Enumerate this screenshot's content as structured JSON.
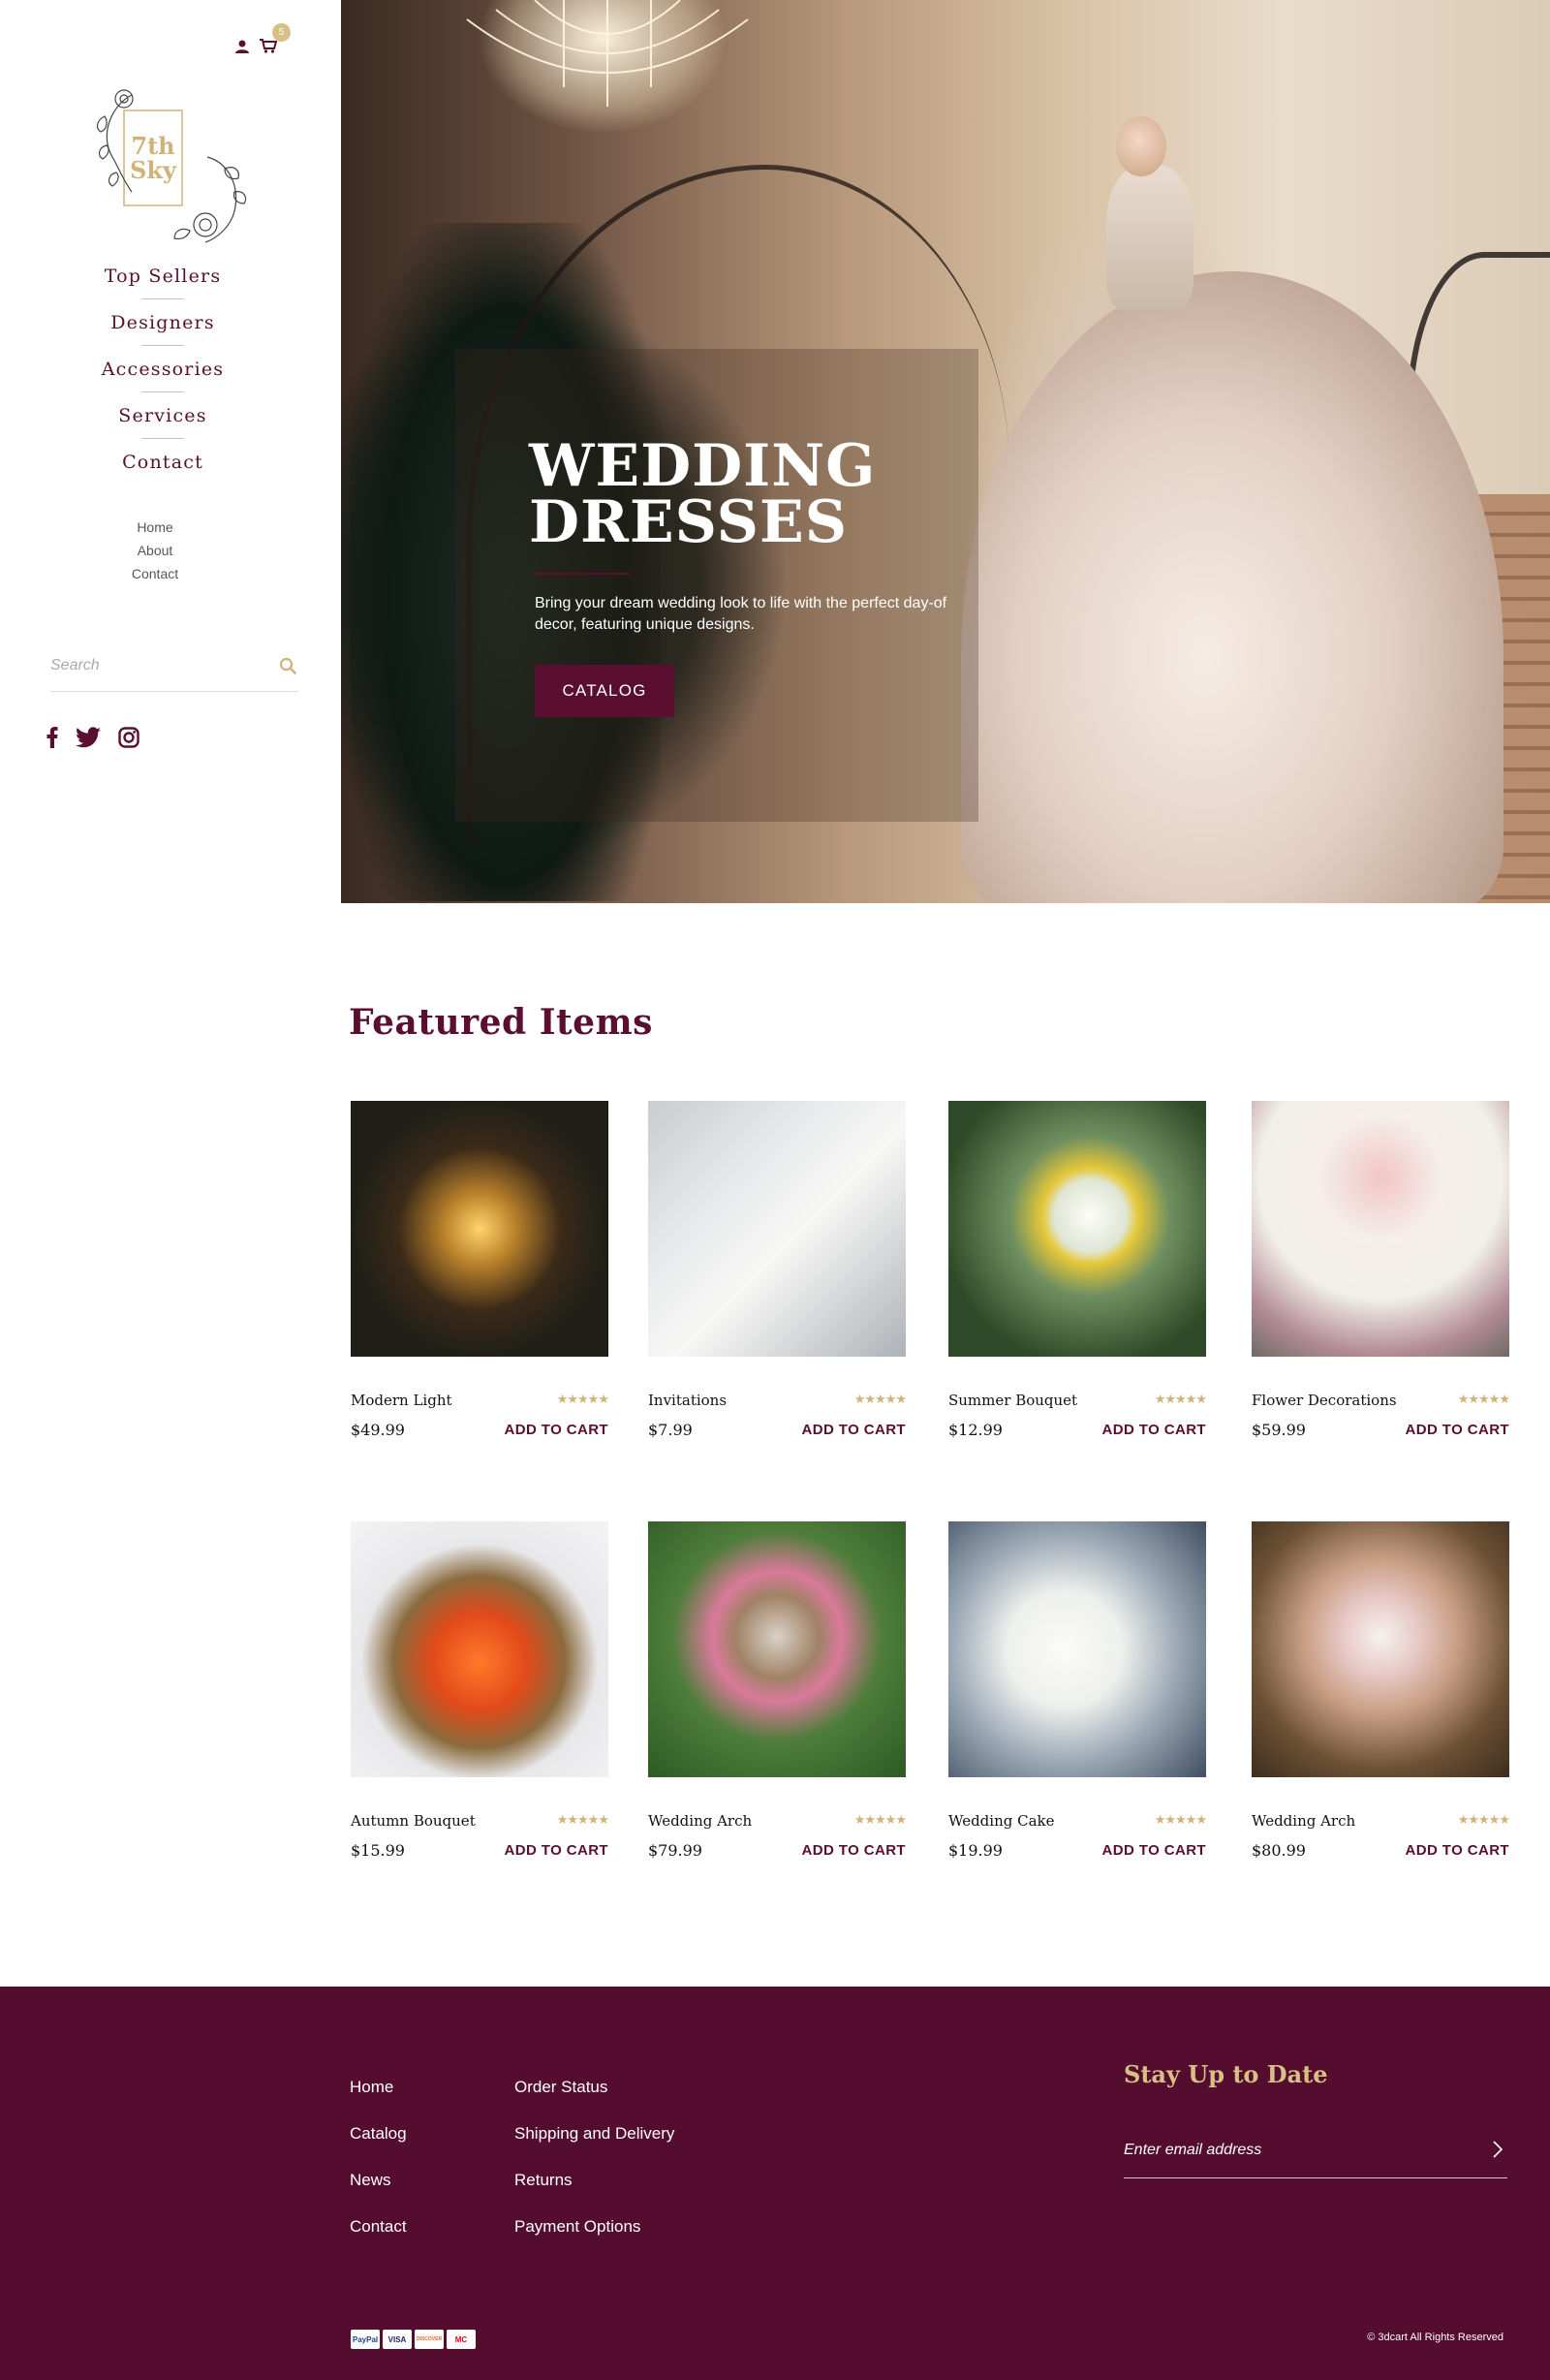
{
  "header": {
    "cart_count": "5",
    "logo_line1": "7th",
    "logo_line2": "Sky"
  },
  "category_nav": [
    "Top Sellers",
    "Designers",
    "Accessories",
    "Services",
    "Contact"
  ],
  "sub_nav": [
    "Home",
    "About",
    "Contact"
  ],
  "search": {
    "placeholder": "Search"
  },
  "hero": {
    "title_line1": "WEDDING",
    "title_line2": "DRESSES",
    "description": "Bring your dream wedding look to life with the perfect day-of decor, featuring unique designs.",
    "button_label": "CATALOG"
  },
  "featured": {
    "title": "Featured Items",
    "add_to_cart_label": "ADD TO CART",
    "stars": "★★★★★",
    "products": [
      {
        "name": "Modern Light",
        "price": "$49.99"
      },
      {
        "name": "Invitations",
        "price": "$7.99"
      },
      {
        "name": "Summer Bouquet",
        "price": "$12.99"
      },
      {
        "name": "Flower Decorations",
        "price": "$59.99"
      },
      {
        "name": "Autumn Bouquet",
        "price": "$15.99"
      },
      {
        "name": "Wedding Arch",
        "price": "$79.99"
      },
      {
        "name": "Wedding Cake",
        "price": "$19.99"
      },
      {
        "name": "Wedding Arch",
        "price": "$80.99"
      }
    ]
  },
  "footer": {
    "col1": [
      "Home",
      "Catalog",
      "News",
      "Contact"
    ],
    "col2": [
      "Order Status",
      "Shipping and Delivery",
      "Returns",
      "Payment Options"
    ],
    "newsletter_title": "Stay Up to Date",
    "email_placeholder": "Enter email address",
    "payments": [
      "PayPal",
      "VISA",
      "DISCOVER",
      "MC"
    ],
    "copyright": "© 3dcart All Rights Reserved"
  },
  "colors": {
    "brand": "#5a0f30",
    "gold": "#d1b27a",
    "footer_bg": "#540d2e"
  }
}
